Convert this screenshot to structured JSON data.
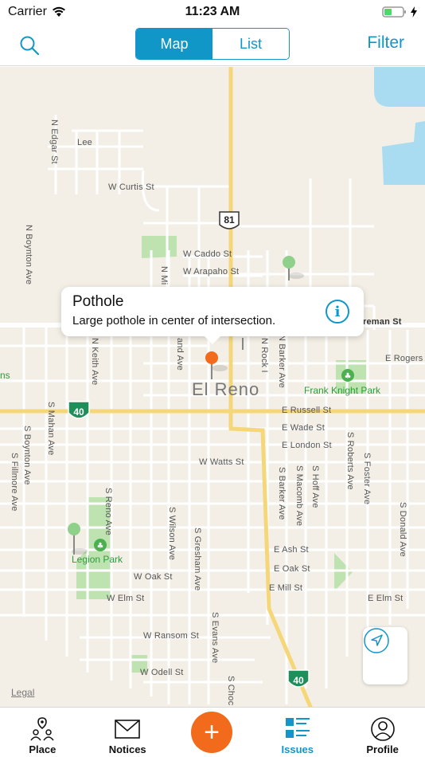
{
  "status_bar": {
    "carrier": "Carrier",
    "time": "11:23 AM"
  },
  "nav": {
    "segments": [
      {
        "label": "Map",
        "active": true
      },
      {
        "label": "List",
        "active": false
      }
    ],
    "filter_label": "Filter"
  },
  "map": {
    "city": "El Reno",
    "streets": [
      {
        "text": "N Edgar St",
        "vertical": true
      },
      {
        "text": "Lee"
      },
      {
        "text": "W Curtis St"
      },
      {
        "text": "N Boynton Ave",
        "vertical": true
      },
      {
        "text": "W Caddo St"
      },
      {
        "text": "W Arapaho St"
      },
      {
        "text": "N Keith Ave",
        "vertical": true
      },
      {
        "text": "E Rogers"
      },
      {
        "text": "E Russell St"
      },
      {
        "text": "E Wade St"
      },
      {
        "text": "E London St"
      },
      {
        "text": "W Watts St"
      },
      {
        "text": "S Mahan Ave",
        "vertical": true
      },
      {
        "text": "S Boynton Ave",
        "vertical": true
      },
      {
        "text": "S Fillmore Ave",
        "vertical": true
      },
      {
        "text": "S Reno Ave",
        "vertical": true
      },
      {
        "text": "S Wilson Ave",
        "vertical": true
      },
      {
        "text": "S Gresham Ave",
        "vertical": true
      },
      {
        "text": "S Barker Ave",
        "vertical": true
      },
      {
        "text": "S Macomb Ave",
        "vertical": true
      },
      {
        "text": "S Hoff Ave",
        "vertical": true
      },
      {
        "text": "S Roberts Ave",
        "vertical": true
      },
      {
        "text": "S Foster Ave",
        "vertical": true
      },
      {
        "text": "S Donald Ave",
        "vertical": true
      },
      {
        "text": "E Ash St"
      },
      {
        "text": "E Oak St"
      },
      {
        "text": "W Oak St"
      },
      {
        "text": "E Mill St"
      },
      {
        "text": "W Elm St"
      },
      {
        "text": "E Elm St"
      },
      {
        "text": "W Ransom St"
      },
      {
        "text": "S Evans Ave",
        "vertical": true
      },
      {
        "text": "W Odell St"
      },
      {
        "text": "S Choc",
        "vertical": true
      },
      {
        "text": "N Rock I",
        "vertical": true
      },
      {
        "text": "N Barker Ave",
        "vertical": true
      },
      {
        "text": "N Mi",
        "vertical": true
      },
      {
        "text": "and Ave",
        "vertical": true
      },
      {
        "text": "reman St"
      },
      {
        "text": "ns"
      }
    ],
    "parks": [
      "Frank Knight Park",
      "Legion Park"
    ],
    "highways": [
      "81",
      "40",
      "40"
    ],
    "callout": {
      "title": "Pothole",
      "subtitle": "Large pothole in center of intersection.",
      "info_icon": "info-icon"
    },
    "legal": "Legal",
    "colors": {
      "land": "#f3efe6",
      "water": "#a9dcf1",
      "park": "#bfe3b0",
      "road_major": "#f5d77a",
      "road": "#ffffff",
      "pin_orange": "#f26a1b",
      "pin_green": "#8fd18a"
    }
  },
  "tabs": [
    {
      "label": "Place",
      "icon": "place-icon"
    },
    {
      "label": "Notices",
      "icon": "mail-icon"
    },
    {
      "label": "Issues",
      "icon": "list-icon",
      "active": true
    },
    {
      "label": "Profile",
      "icon": "profile-icon"
    }
  ],
  "add_button": "+",
  "accent": "#1196c8"
}
